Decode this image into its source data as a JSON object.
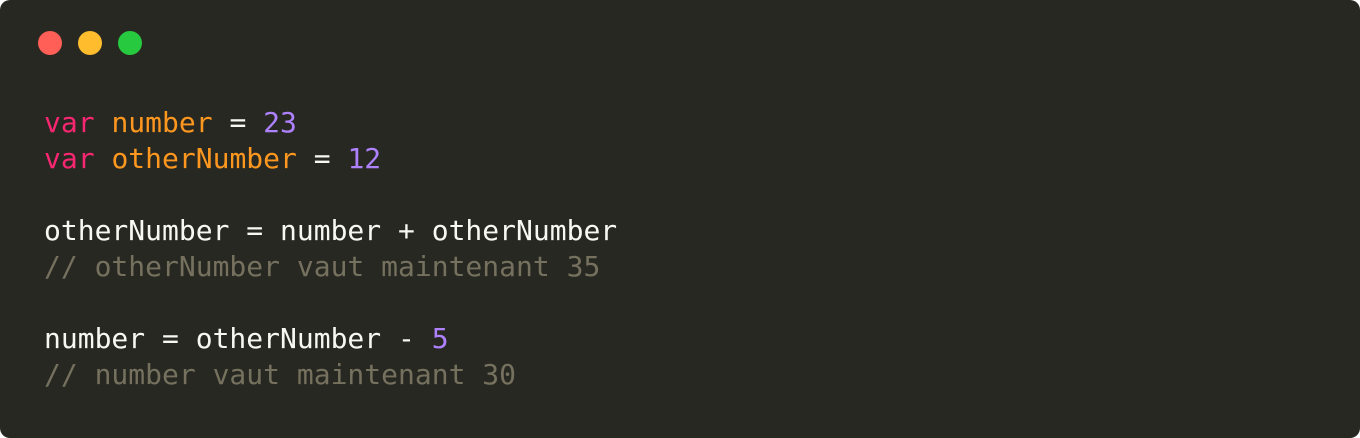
{
  "window": {
    "traffic_lights": [
      {
        "name": "close",
        "color": "#ff5f56"
      },
      {
        "name": "minimize",
        "color": "#ffbd2e"
      },
      {
        "name": "maximize",
        "color": "#27c93f"
      }
    ]
  },
  "theme": {
    "background": "#272822",
    "keyword": "#f92672",
    "variable": "#fd971f",
    "number": "#ae81ff",
    "text": "#f8f8f2",
    "comment": "#75715e"
  },
  "code": {
    "lines": [
      [
        {
          "type": "keyword",
          "text": "var"
        },
        {
          "type": "plain",
          "text": " "
        },
        {
          "type": "ident-var",
          "text": "number"
        },
        {
          "type": "plain",
          "text": " = "
        },
        {
          "type": "number",
          "text": "23"
        }
      ],
      [
        {
          "type": "keyword",
          "text": "var"
        },
        {
          "type": "plain",
          "text": " "
        },
        {
          "type": "ident-var",
          "text": "otherNumber"
        },
        {
          "type": "plain",
          "text": " = "
        },
        {
          "type": "number",
          "text": "12"
        }
      ],
      [],
      [
        {
          "type": "plain",
          "text": "otherNumber = number + otherNumber"
        }
      ],
      [
        {
          "type": "comment",
          "text": "// otherNumber vaut maintenant 35"
        }
      ],
      [],
      [
        {
          "type": "plain",
          "text": "number = otherNumber - "
        },
        {
          "type": "number",
          "text": "5"
        }
      ],
      [
        {
          "type": "comment",
          "text": "// number vaut maintenant 30"
        }
      ]
    ]
  }
}
